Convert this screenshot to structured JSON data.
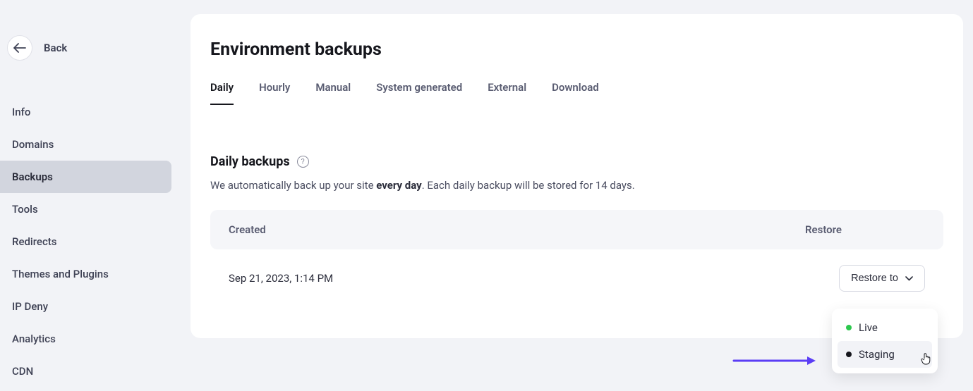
{
  "back": {
    "label": "Back"
  },
  "sidebar": {
    "items": [
      {
        "label": "Info"
      },
      {
        "label": "Domains"
      },
      {
        "label": "Backups"
      },
      {
        "label": "Tools"
      },
      {
        "label": "Redirects"
      },
      {
        "label": "Themes and Plugins"
      },
      {
        "label": "IP Deny"
      },
      {
        "label": "Analytics"
      },
      {
        "label": "CDN"
      }
    ],
    "active_index": 2
  },
  "page": {
    "title": "Environment backups"
  },
  "tabs": {
    "items": [
      {
        "label": "Daily"
      },
      {
        "label": "Hourly"
      },
      {
        "label": "Manual"
      },
      {
        "label": "System generated"
      },
      {
        "label": "External"
      },
      {
        "label": "Download"
      }
    ],
    "active_index": 0
  },
  "section": {
    "title": "Daily backups",
    "desc_prefix": "We automatically back up your site ",
    "desc_bold": "every day",
    "desc_suffix": ". Each daily backup will be stored for 14 days."
  },
  "table": {
    "headers": {
      "created": "Created",
      "restore": "Restore"
    },
    "rows": [
      {
        "created": "Sep 21, 2023, 1:14 PM"
      }
    ]
  },
  "restore_button": {
    "label": "Restore to"
  },
  "dropdown": {
    "items": [
      {
        "label": "Live",
        "dot": "green"
      },
      {
        "label": "Staging",
        "dot": "black"
      }
    ],
    "hovered_index": 1
  }
}
